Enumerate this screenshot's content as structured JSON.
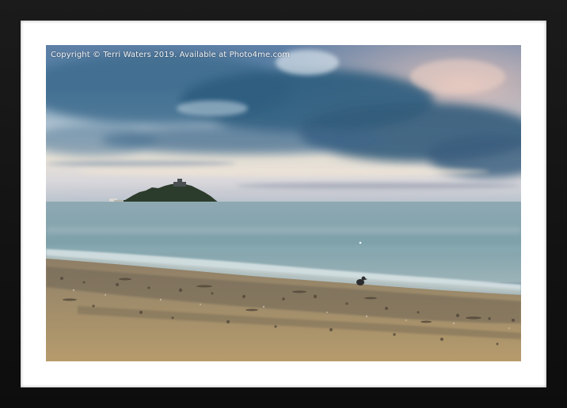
{
  "photo": {
    "watermark": "Copyright  © Terri Waters  2019. Available at Photo4me.com"
  },
  "colors": {
    "frame": "#111111",
    "mat": "#ffffff",
    "sea": "#7fa3ad",
    "sand": "#a8916a",
    "cloud_dark": "#34607e"
  }
}
